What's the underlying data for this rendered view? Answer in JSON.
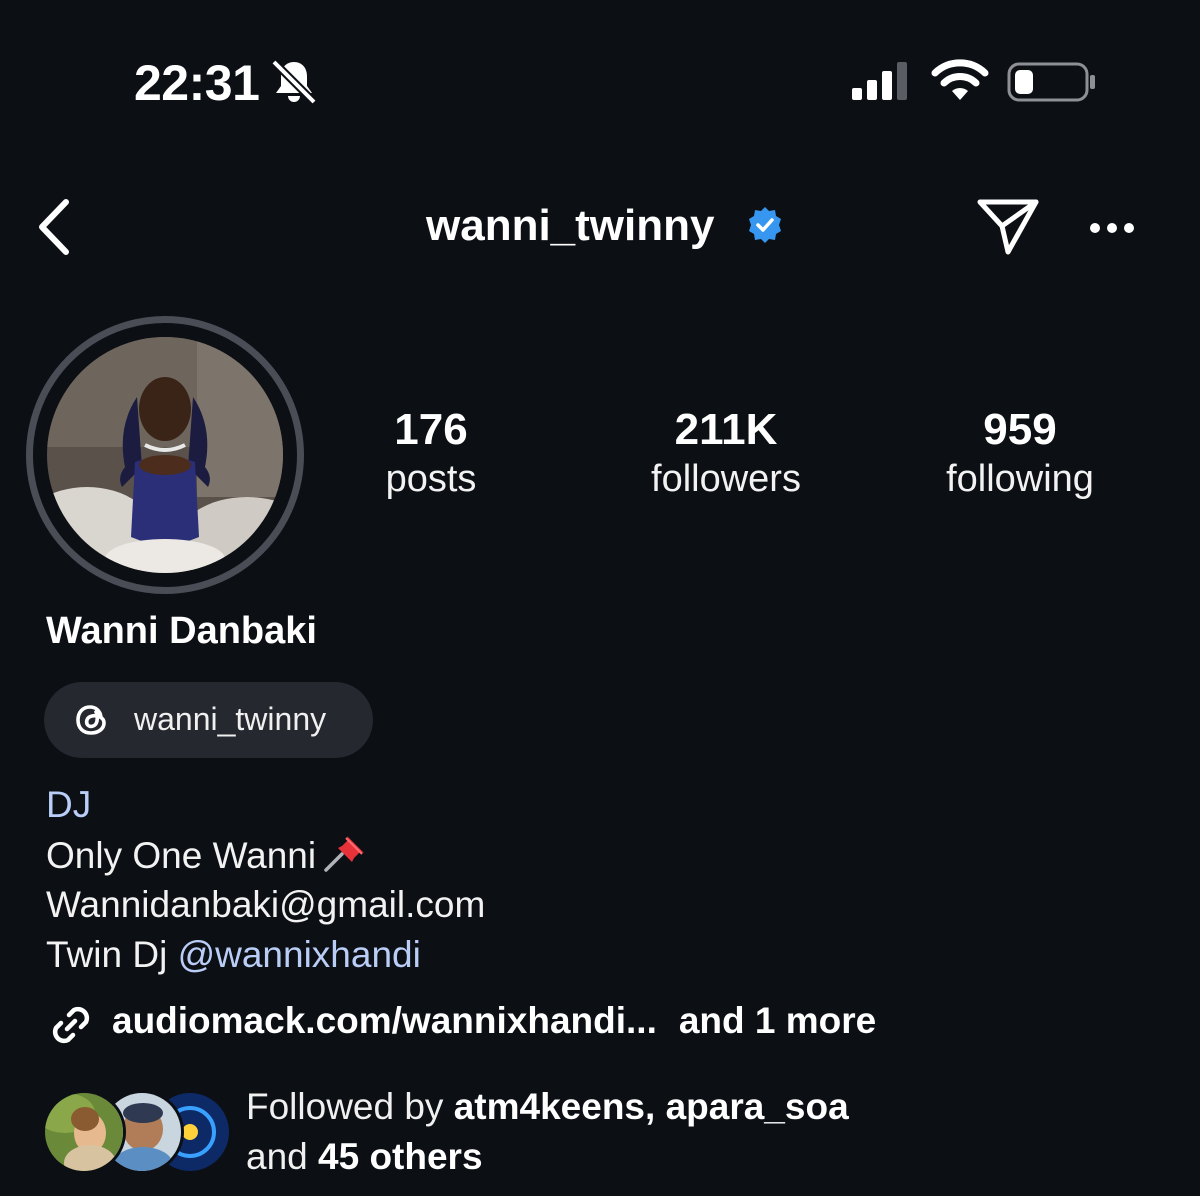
{
  "status_bar": {
    "time": "22:31",
    "icons": [
      "bell-off-icon",
      "signal-icon",
      "wifi-icon",
      "battery-icon"
    ]
  },
  "header": {
    "username": "wanni_twinny",
    "verified": true,
    "icons": [
      "back-icon",
      "send-icon",
      "more-icon"
    ]
  },
  "stats": {
    "posts": {
      "value": "176",
      "label": "posts"
    },
    "followers": {
      "value": "211K",
      "label": "followers"
    },
    "following": {
      "value": "959",
      "label": "following"
    }
  },
  "profile": {
    "name": "Wanni Danbaki",
    "threads_handle": "wanni_twinny"
  },
  "bio": {
    "category": "DJ",
    "tagline": "Only One Wanni",
    "email": "Wannidanbaki@gmail.com",
    "twin_prefix": "Twin Dj ",
    "twin_mention": "@wannixhandi"
  },
  "link": {
    "url": "audiomack.com/wannixhandi...",
    "more": "and 1 more"
  },
  "followed_by": {
    "prefix": "Followed by ",
    "name1": "atm4keens",
    "separator": ", ",
    "name2": "apara_soa",
    "and_prefix": "and ",
    "others": "45 others"
  },
  "colors": {
    "background": "#0c0f14",
    "link_blue": "#b9cdf7",
    "verified_blue": "#3797f0",
    "pill_bg": "#25282e"
  }
}
